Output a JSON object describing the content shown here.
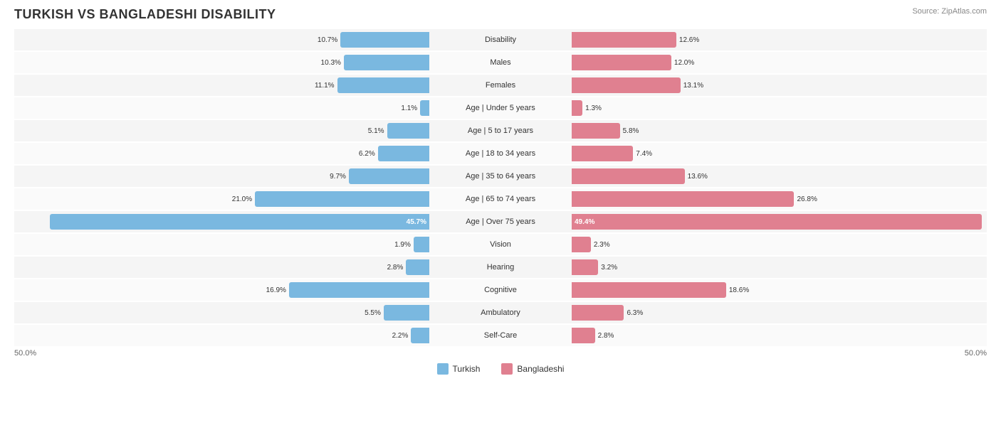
{
  "title": "TURKISH VS BANGLADESHI DISABILITY",
  "source": "Source: ZipAtlas.com",
  "colors": {
    "blue": "#7ab8e0",
    "pink": "#e08090"
  },
  "legend": {
    "blue_label": "Turkish",
    "pink_label": "Bangladeshi"
  },
  "axis": {
    "left": "50.0%",
    "right": "50.0%"
  },
  "rows": [
    {
      "label": "Disability",
      "left_val": "10.7%",
      "right_val": "12.6%",
      "left_pct": 10.7,
      "right_pct": 12.6,
      "inside": false
    },
    {
      "label": "Males",
      "left_val": "10.3%",
      "right_val": "12.0%",
      "left_pct": 10.3,
      "right_pct": 12.0,
      "inside": false
    },
    {
      "label": "Females",
      "left_val": "11.1%",
      "right_val": "13.1%",
      "left_pct": 11.1,
      "right_pct": 13.1,
      "inside": false
    },
    {
      "label": "Age | Under 5 years",
      "left_val": "1.1%",
      "right_val": "1.3%",
      "left_pct": 1.1,
      "right_pct": 1.3,
      "inside": false
    },
    {
      "label": "Age | 5 to 17 years",
      "left_val": "5.1%",
      "right_val": "5.8%",
      "left_pct": 5.1,
      "right_pct": 5.8,
      "inside": false
    },
    {
      "label": "Age | 18 to 34 years",
      "left_val": "6.2%",
      "right_val": "7.4%",
      "left_pct": 6.2,
      "right_pct": 7.4,
      "inside": false
    },
    {
      "label": "Age | 35 to 64 years",
      "left_val": "9.7%",
      "right_val": "13.6%",
      "left_pct": 9.7,
      "right_pct": 13.6,
      "inside": false
    },
    {
      "label": "Age | 65 to 74 years",
      "left_val": "21.0%",
      "right_val": "26.8%",
      "left_pct": 21.0,
      "right_pct": 26.8,
      "inside": false
    },
    {
      "label": "Age | Over 75 years",
      "left_val": "45.7%",
      "right_val": "49.4%",
      "left_pct": 45.7,
      "right_pct": 49.4,
      "inside": true
    },
    {
      "label": "Vision",
      "left_val": "1.9%",
      "right_val": "2.3%",
      "left_pct": 1.9,
      "right_pct": 2.3,
      "inside": false
    },
    {
      "label": "Hearing",
      "left_val": "2.8%",
      "right_val": "3.2%",
      "left_pct": 2.8,
      "right_pct": 3.2,
      "inside": false
    },
    {
      "label": "Cognitive",
      "left_val": "16.9%",
      "right_val": "18.6%",
      "left_pct": 16.9,
      "right_pct": 18.6,
      "inside": false
    },
    {
      "label": "Ambulatory",
      "left_val": "5.5%",
      "right_val": "6.3%",
      "left_pct": 5.5,
      "right_pct": 6.3,
      "inside": false
    },
    {
      "label": "Self-Care",
      "left_val": "2.2%",
      "right_val": "2.8%",
      "left_pct": 2.2,
      "right_pct": 2.8,
      "inside": false
    }
  ]
}
